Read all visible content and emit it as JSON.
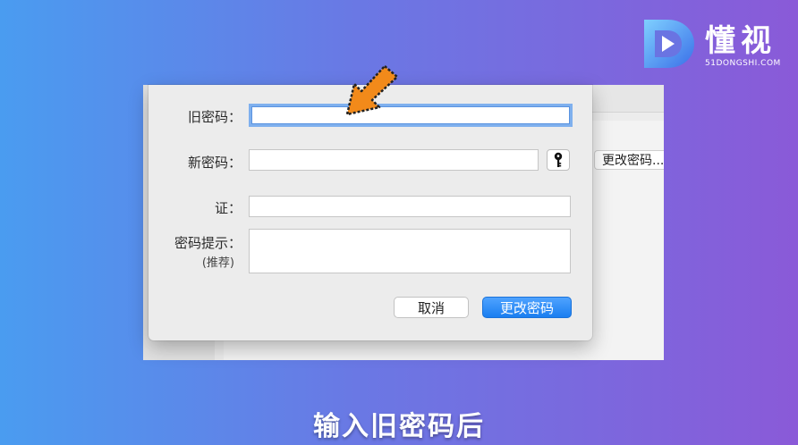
{
  "watermark": {
    "brand_cn": "懂视",
    "brand_en": "51DONGSHI.COM"
  },
  "background_window": {
    "change_password_button_label": "更改密码..."
  },
  "dialog": {
    "old_password_label": "旧密码：",
    "old_password_value": "",
    "new_password_label": "新密码：",
    "new_password_value": "",
    "key_icon": "key-icon",
    "verify_label": "证：",
    "verify_value": "",
    "hint_label": "密码提示：",
    "hint_sublabel": "(推荐)",
    "hint_value": "",
    "cancel_label": "取消",
    "change_password_label": "更改密码"
  },
  "annotation": {
    "arrow_color": "#f28a1a",
    "caption": "输入旧密码后"
  },
  "colors": {
    "accent": "#1a7ef0",
    "focus_ring": "#7fb0ee"
  }
}
